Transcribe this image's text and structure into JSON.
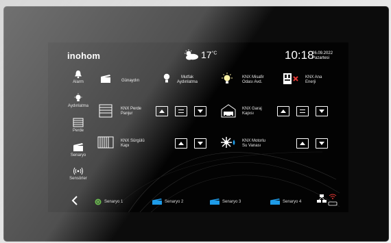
{
  "brand": "inohom",
  "weather": {
    "temperature": "17",
    "unit": "°C",
    "icon": "sun-cloud-icon"
  },
  "clock": {
    "time": "10:18",
    "date": "26.09.2022",
    "day": "Pazartesi"
  },
  "sidebar": {
    "items": [
      {
        "label": "Alarm",
        "icon": "bell-icon"
      },
      {
        "label": "Aydınlatma",
        "icon": "bulb-icon"
      },
      {
        "label": "Perde",
        "icon": "curtain-icon"
      },
      {
        "label": "Senaryo",
        "icon": "scenario-icon"
      },
      {
        "label": "Sensörler",
        "icon": "sensor-icon"
      }
    ]
  },
  "tiles": {
    "gunaydin": "Günaydın",
    "mutfak": [
      "Mutfak",
      "Aydınlatma"
    ],
    "misafir": [
      "KNX Misafir",
      "Odası Avd."
    ],
    "ana_enerji": [
      "KNX Ana",
      "Enerji"
    ],
    "perde": [
      "KNX Perde",
      "Panjur"
    ],
    "garaj": [
      "KNX Garaj",
      "Kapısı"
    ],
    "surgulu": [
      "KNX Sürgülü",
      "Kapı"
    ],
    "motorlu": [
      "KNX Motorlu",
      "Su Vanası"
    ]
  },
  "scenarios": [
    "Senaryo 1",
    "Senaryo 2",
    "Senaryo 3",
    "Senaryo 4"
  ],
  "colors": {
    "accent_blue": "#1e9be8",
    "accent_green": "#4caf2a",
    "alert_red": "#e53935"
  }
}
